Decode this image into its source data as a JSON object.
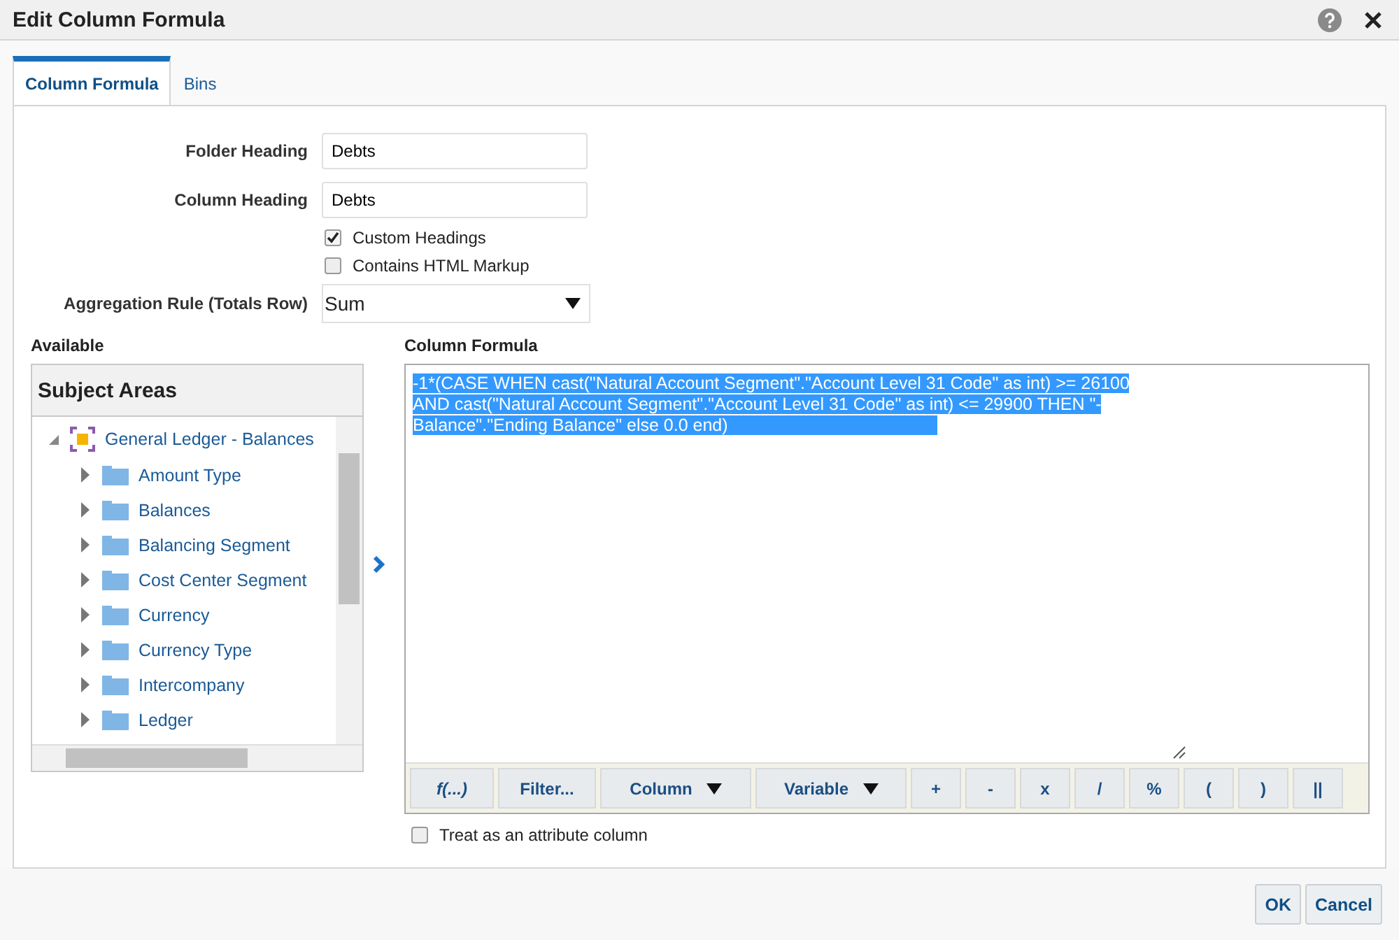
{
  "window": {
    "title": "Edit Column Formula"
  },
  "tabs": [
    {
      "label": "Column Formula",
      "selected": true
    },
    {
      "label": "Bins",
      "selected": false
    }
  ],
  "form": {
    "folder_heading": {
      "label": "Folder Heading",
      "value": "Debts"
    },
    "column_heading": {
      "label": "Column Heading",
      "value": "Debts"
    },
    "checkboxes": [
      {
        "label": "Custom Headings",
        "checked": true
      },
      {
        "label": "Contains HTML Markup",
        "checked": false
      }
    ],
    "aggregation": {
      "label": "Aggregation Rule (Totals Row)",
      "value": "Sum"
    }
  },
  "available": {
    "label": "Available",
    "panel_title": "Subject Areas",
    "tree": [
      {
        "label": "General Ledger - Balances",
        "expanded": true,
        "children": [
          {
            "label": "Amount Type",
            "expanded": false
          },
          {
            "label": "Balances",
            "expanded": false
          },
          {
            "label": "Balancing Segment",
            "expanded": false
          },
          {
            "label": "Cost Center Segment",
            "expanded": false
          },
          {
            "label": "Currency",
            "expanded": false
          },
          {
            "label": "Currency Type",
            "expanded": false
          },
          {
            "label": "Intercompany",
            "expanded": false
          },
          {
            "label": "Ledger",
            "expanded": false
          }
        ]
      }
    ]
  },
  "formula": {
    "label": "Column Formula",
    "selected": true,
    "value": "-1*(CASE  WHEN cast(\"Natural Account Segment\".\"Account Level 31 Code\"  as int)  >= 26100 AND  cast(\"Natural Account Segment\".\"Account Level 31 Code\"  as int)  <= 29900 THEN \"- Balance\".\"Ending Balance\" else 0.0 end)",
    "toolbar": [
      {
        "label": "f(...)",
        "kind": "function"
      },
      {
        "label": "Filter...",
        "kind": "plain"
      },
      {
        "label": "Column",
        "kind": "dropdown"
      },
      {
        "label": "Variable",
        "kind": "dropdown"
      },
      {
        "label": "+",
        "kind": "plain"
      },
      {
        "label": "-",
        "kind": "plain"
      },
      {
        "label": "x",
        "kind": "plain"
      },
      {
        "label": "/",
        "kind": "plain"
      },
      {
        "label": "%",
        "kind": "plain"
      },
      {
        "label": "(",
        "kind": "plain"
      },
      {
        "label": ")",
        "kind": "plain"
      },
      {
        "label": "||",
        "kind": "plain"
      }
    ],
    "attribute_checkbox": {
      "label": "Treat as an attribute column",
      "checked": false
    }
  },
  "buttons": [
    "OK",
    "Cancel"
  ]
}
